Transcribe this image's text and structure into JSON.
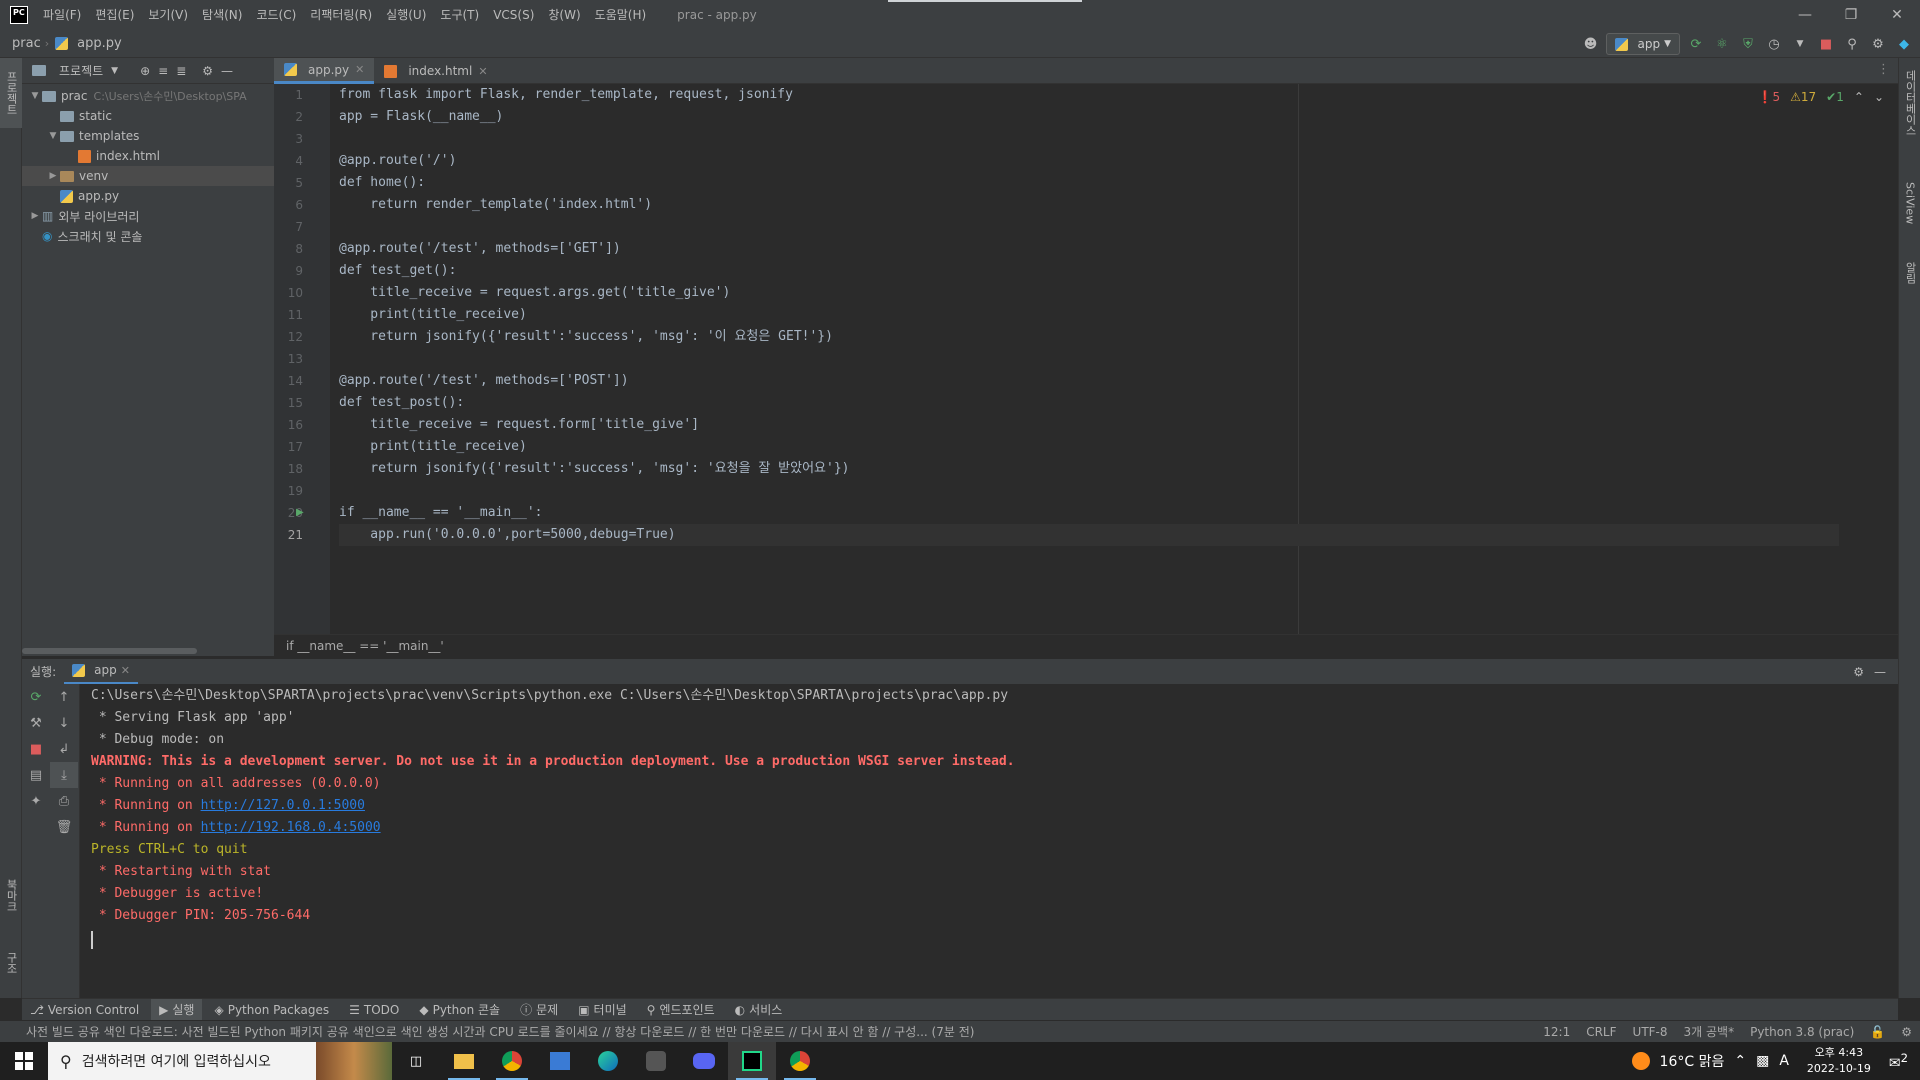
{
  "titlebar": {
    "logo": "PC",
    "menu": [
      "파일(F)",
      "편집(E)",
      "보기(V)",
      "탐색(N)",
      "코드(C)",
      "리팩터링(R)",
      "실행(U)",
      "도구(T)",
      "VCS(S)",
      "창(W)",
      "도움말(H)"
    ],
    "window_title": "prac - app.py"
  },
  "navbar": {
    "project": "prac",
    "file": "app.py",
    "run_config": "app"
  },
  "stripes": {
    "project": "프로젝트",
    "structure": "구조",
    "bookmarks": "북마크",
    "database": "데이터베이스",
    "sciview": "SciView",
    "notifications": "알림"
  },
  "project_panel": {
    "title": "프로젝트",
    "tree": [
      {
        "label": "prac",
        "hint": "C:\\Users\\손수민\\Desktop\\SPA",
        "type": "folder",
        "depth": 0,
        "expanded": true
      },
      {
        "label": "static",
        "type": "folder",
        "depth": 1
      },
      {
        "label": "templates",
        "type": "folder",
        "depth": 1,
        "expanded": true
      },
      {
        "label": "index.html",
        "type": "html",
        "depth": 2
      },
      {
        "label": "venv",
        "type": "venv",
        "depth": 1,
        "collapsed": true,
        "selected": true
      },
      {
        "label": "app.py",
        "type": "py",
        "depth": 1
      },
      {
        "label": "외부 라이브러리",
        "type": "lib",
        "depth": 0,
        "collapsed": true
      },
      {
        "label": "스크래치 및 콘솔",
        "type": "scratch",
        "depth": 0
      }
    ]
  },
  "editor": {
    "tabs": [
      {
        "label": "app.py",
        "active": true
      },
      {
        "label": "index.html",
        "active": false
      }
    ],
    "inspections": {
      "errors": "5",
      "warnings": "17",
      "ok": "1"
    },
    "code_lines": [
      "from flask import Flask, render_template, request, jsonify",
      "app = Flask(__name__)",
      "",
      "@app.route('/')",
      "def home():",
      "    return render_template('index.html')",
      "",
      "@app.route('/test', methods=['GET'])",
      "def test_get():",
      "    title_receive = request.args.get('title_give')",
      "    print(title_receive)",
      "    return jsonify({'result':'success', 'msg': '이 요청은 GET!'})",
      "",
      "@app.route('/test', methods=['POST'])",
      "def test_post():",
      "    title_receive = request.form['title_give']",
      "    print(title_receive)",
      "    return jsonify({'result':'success', 'msg': '요청을 잘 받았어요'})",
      "",
      "if __name__ == '__main__':",
      "    app.run('0.0.0.0',port=5000,debug=True)"
    ],
    "current_line": 21,
    "breadcrumb": "if __name__ == '__main__'"
  },
  "run_panel": {
    "label": "실행:",
    "tab": "app",
    "console": [
      {
        "text": "C:\\Users\\손수민\\Desktop\\SPARTA\\projects\\prac\\venv\\Scripts\\python.exe C:\\Users\\손수민\\Desktop\\SPARTA\\projects\\prac\\app.py",
        "style": "normal"
      },
      {
        "text": " * Serving Flask app 'app'",
        "style": "normal"
      },
      {
        "text": " * Debug mode: on",
        "style": "normal"
      },
      {
        "text": "WARNING: This is a development server. Do not use it in a production deployment. Use a production WSGI server instead.",
        "style": "red-bold"
      },
      {
        "text": " * Running on all addresses (0.0.0.0)",
        "style": "red"
      },
      {
        "text": " * Running on ",
        "link": "http://127.0.0.1:5000",
        "style": "red"
      },
      {
        "text": " * Running on ",
        "link": "http://192.168.0.4:5000",
        "style": "red"
      },
      {
        "text": "Press CTRL+C to quit",
        "style": "yellow"
      },
      {
        "text": " * Restarting with stat",
        "style": "red"
      },
      {
        "text": " * Debugger is active!",
        "style": "red"
      },
      {
        "text": " * Debugger PIN: 205-756-644",
        "style": "red"
      }
    ]
  },
  "bottom_tools": [
    "Version Control",
    "실행",
    "Python Packages",
    "TODO",
    "Python 콘솔",
    "문제",
    "터미널",
    "엔드포인트",
    "서비스"
  ],
  "statusbar": {
    "message": "사전 빌드 공유 색인 다운로드: 사전 빌드된 Python 패키지 공유 색인으로 색인 생성 시간과 CPU 로드를 줄이세요 // 항상 다운로드 // 한 번만 다운로드 // 다시 표시 안 함 // 구성... (7분 전)",
    "position": "12:1",
    "line_sep": "CRLF",
    "encoding": "UTF-8",
    "indent": "3개 공백*",
    "interpreter": "Python 3.8 (prac)"
  },
  "taskbar": {
    "search_placeholder": "검색하려면 여기에 입력하십시오",
    "weather": "16°C  맑음",
    "ime": "A",
    "time": "오후 4:43",
    "date": "2022-10-19",
    "notification_count": "2"
  }
}
